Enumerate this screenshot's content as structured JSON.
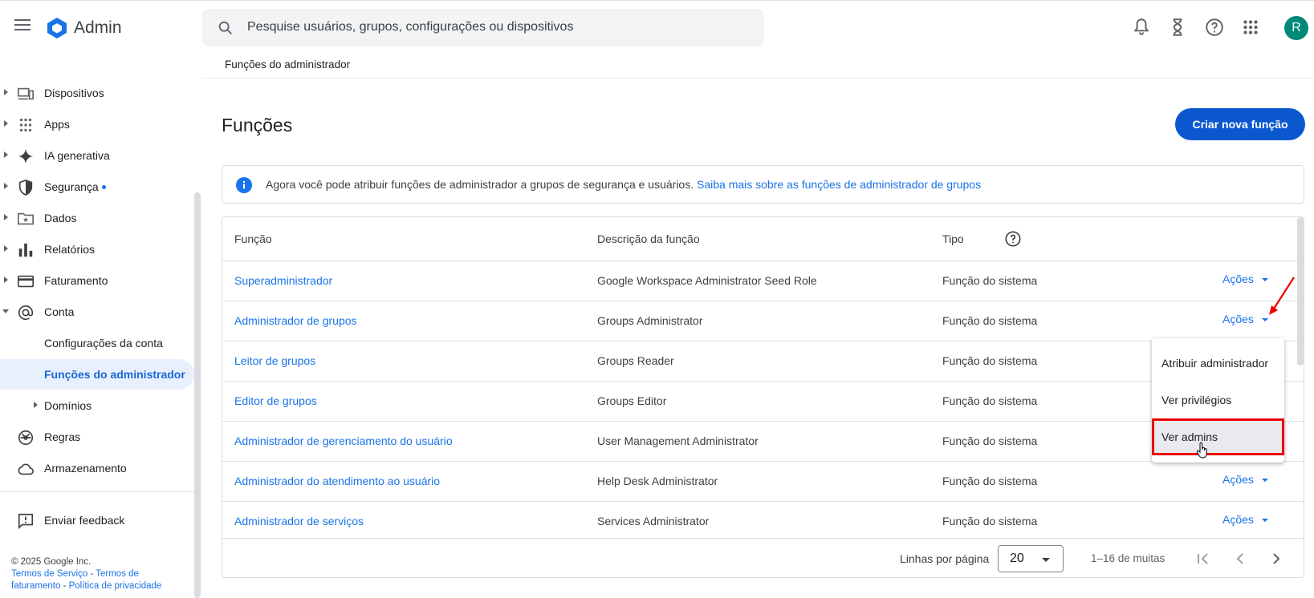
{
  "header": {
    "app_title": "Admin",
    "search_placeholder": "Pesquise usuários, grupos, configurações ou dispositivos",
    "avatar_letter": "R",
    "avatar_color": "#00897b"
  },
  "sidebar": {
    "items": [
      {
        "label": "Dispositivos"
      },
      {
        "label": "Apps"
      },
      {
        "label": "IA generativa"
      },
      {
        "label": "Segurança"
      },
      {
        "label": "Dados"
      },
      {
        "label": "Relatórios"
      },
      {
        "label": "Faturamento"
      },
      {
        "label": "Conta"
      },
      {
        "label": "Configurações da conta"
      },
      {
        "label": "Funções do administrador"
      },
      {
        "label": "Domínios"
      },
      {
        "label": "Regras"
      },
      {
        "label": "Armazenamento"
      }
    ],
    "feedback": "Enviar feedback",
    "footer": {
      "copyright": "© 2025 Google Inc.",
      "terms": "Termos de Serviço",
      "sep1": " - ",
      "billing_terms": "Termos de faturamento",
      "sep2": " - ",
      "privacy": "Política de privacidade"
    }
  },
  "main": {
    "breadcrumb": "Funções do administrador",
    "title": "Funções",
    "create_button": "Criar nova função",
    "banner": {
      "text": "Agora você pode atribuir funções de administrador a grupos de segurança e usuários.",
      "link": "Saiba mais sobre as funções de administrador de grupos"
    },
    "table": {
      "headers": [
        "Função",
        "Descrição da função",
        "Tipo"
      ],
      "actions_label": "Ações",
      "rows": [
        {
          "role": "Superadministrador",
          "description": "Google Workspace Administrator Seed Role",
          "type": "Função do sistema"
        },
        {
          "role": "Administrador de grupos",
          "description": "Groups Administrator",
          "type": "Função do sistema"
        },
        {
          "role": "Leitor de grupos",
          "description": "Groups Reader",
          "type": "Função do sistema"
        },
        {
          "role": "Editor de grupos",
          "description": "Groups Editor",
          "type": "Função do sistema"
        },
        {
          "role": "Administrador de gerenciamento do usuário",
          "description": "User Management Administrator",
          "type": "Função do sistema"
        },
        {
          "role": "Administrador do atendimento ao usuário",
          "description": "Help Desk Administrator",
          "type": "Função do sistema"
        },
        {
          "role": "Administrador de serviços",
          "description": "Services Administrator",
          "type": "Função do sistema"
        }
      ]
    },
    "pagination": {
      "rows_per_page_label": "Linhas por página",
      "rows_per_page_value": "20",
      "range": "1–16 de muitas"
    },
    "actions_menu": {
      "items": [
        "Atribuir administrador",
        "Ver privilégios",
        "Ver admins"
      ]
    }
  },
  "colors": {
    "accent": "#1a73e8",
    "primary_button": "#0b57d0",
    "highlight_box": "#e00000"
  }
}
